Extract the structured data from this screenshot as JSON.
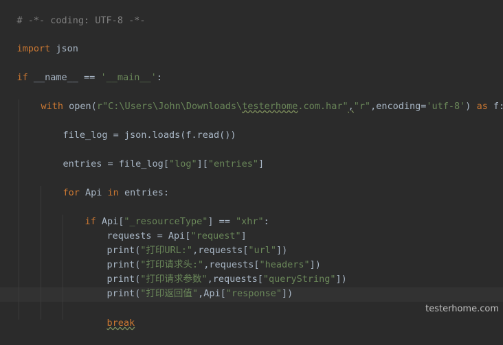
{
  "code": {
    "l1": "# -*- coding: UTF-8 -*-",
    "l2_kw": "import",
    "l2_rest": " json",
    "l3_kw": "if",
    "l3_a": " __name__ == ",
    "l3_str": "'__main__'",
    "l3_b": ":",
    "l4_kw1": "with",
    "l4_a": " open(",
    "l4_str1a": "r\"C:\\Users\\John\\Downloads\\",
    "l4_str1b": "testerhome",
    "l4_str1c": ".com.har\"",
    "l4_c": ",",
    "l4_str2": "\"r\"",
    "l4_d": ",encoding=",
    "l4_str3": "'utf-8'",
    "l4_e": ") ",
    "l4_kw2": "as",
    "l4_f": " f:",
    "l5": "file_log = json.loads(f.read())",
    "l6_a": "entries = file_log[",
    "l6_s1": "\"log\"",
    "l6_b": "][",
    "l6_s2": "\"entries\"",
    "l6_c": "]",
    "l7_kw1": "for",
    "l7_a": " Api ",
    "l7_kw2": "in",
    "l7_b": " entries:",
    "l8_kw": "if",
    "l8_a": " Api[",
    "l8_s1": "\"_resourceType\"",
    "l8_b": "] == ",
    "l8_s2": "\"xhr\"",
    "l8_c": ":",
    "l9_a": "requests = Api[",
    "l9_s": "\"request\"",
    "l9_b": "]",
    "l10_a": "print(",
    "l10_s1": "\"打印URL:\"",
    "l10_b": ",requests[",
    "l10_s2": "\"url\"",
    "l10_c": "])",
    "l11_a": "print(",
    "l11_s1": "\"打印请求头:\"",
    "l11_b": ",requests[",
    "l11_s2": "\"headers\"",
    "l11_c": "])",
    "l12_a": "print(",
    "l12_s1": "\"打印请求参数\"",
    "l12_b": ",requests[",
    "l12_s2": "\"queryString\"",
    "l12_c": "])",
    "l13_a": "print(",
    "l13_s1": "\"打印返回值\"",
    "l13_b": ",Api[",
    "l13_s2": "\"response\"",
    "l13_c": "])",
    "l14_kw": "break"
  },
  "watermark": "testerhome.com"
}
